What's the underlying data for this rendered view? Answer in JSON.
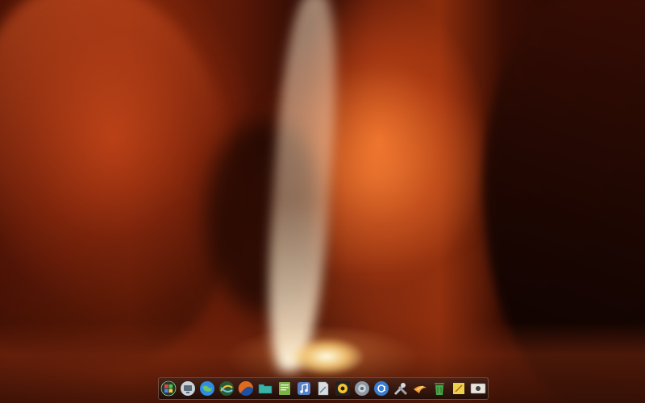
{
  "desktop": {
    "wallpaper": "antelope-canyon-light-beam"
  },
  "dock": {
    "items": [
      {
        "name": "start-orb-icon",
        "color": "#3c7a2c"
      },
      {
        "name": "computer-icon",
        "color": "#c9d2d8"
      },
      {
        "name": "globe-icon",
        "color": "#2f8de0"
      },
      {
        "name": "network-icon",
        "color": "#49a64b"
      },
      {
        "name": "browser-icon",
        "color": "#e06a1d"
      },
      {
        "name": "folder-icon",
        "color": "#39b3a8"
      },
      {
        "name": "notes-icon",
        "color": "#7db24a"
      },
      {
        "name": "music-icon",
        "color": "#5680c8"
      },
      {
        "name": "document-icon",
        "color": "#8a9aa6"
      },
      {
        "name": "settings-icon",
        "color": "#f4c430"
      },
      {
        "name": "system-icon",
        "color": "#8d98a4"
      },
      {
        "name": "messenger-icon",
        "color": "#3a7dd0"
      },
      {
        "name": "tools-icon",
        "color": "#b8bcc4"
      },
      {
        "name": "star-icon",
        "color": "#f0a030"
      },
      {
        "name": "trash-icon",
        "color": "#4aa84a"
      },
      {
        "name": "notepad-icon",
        "color": "#e8d34a"
      },
      {
        "name": "media-icon",
        "color": "#e8e4dc"
      }
    ]
  }
}
